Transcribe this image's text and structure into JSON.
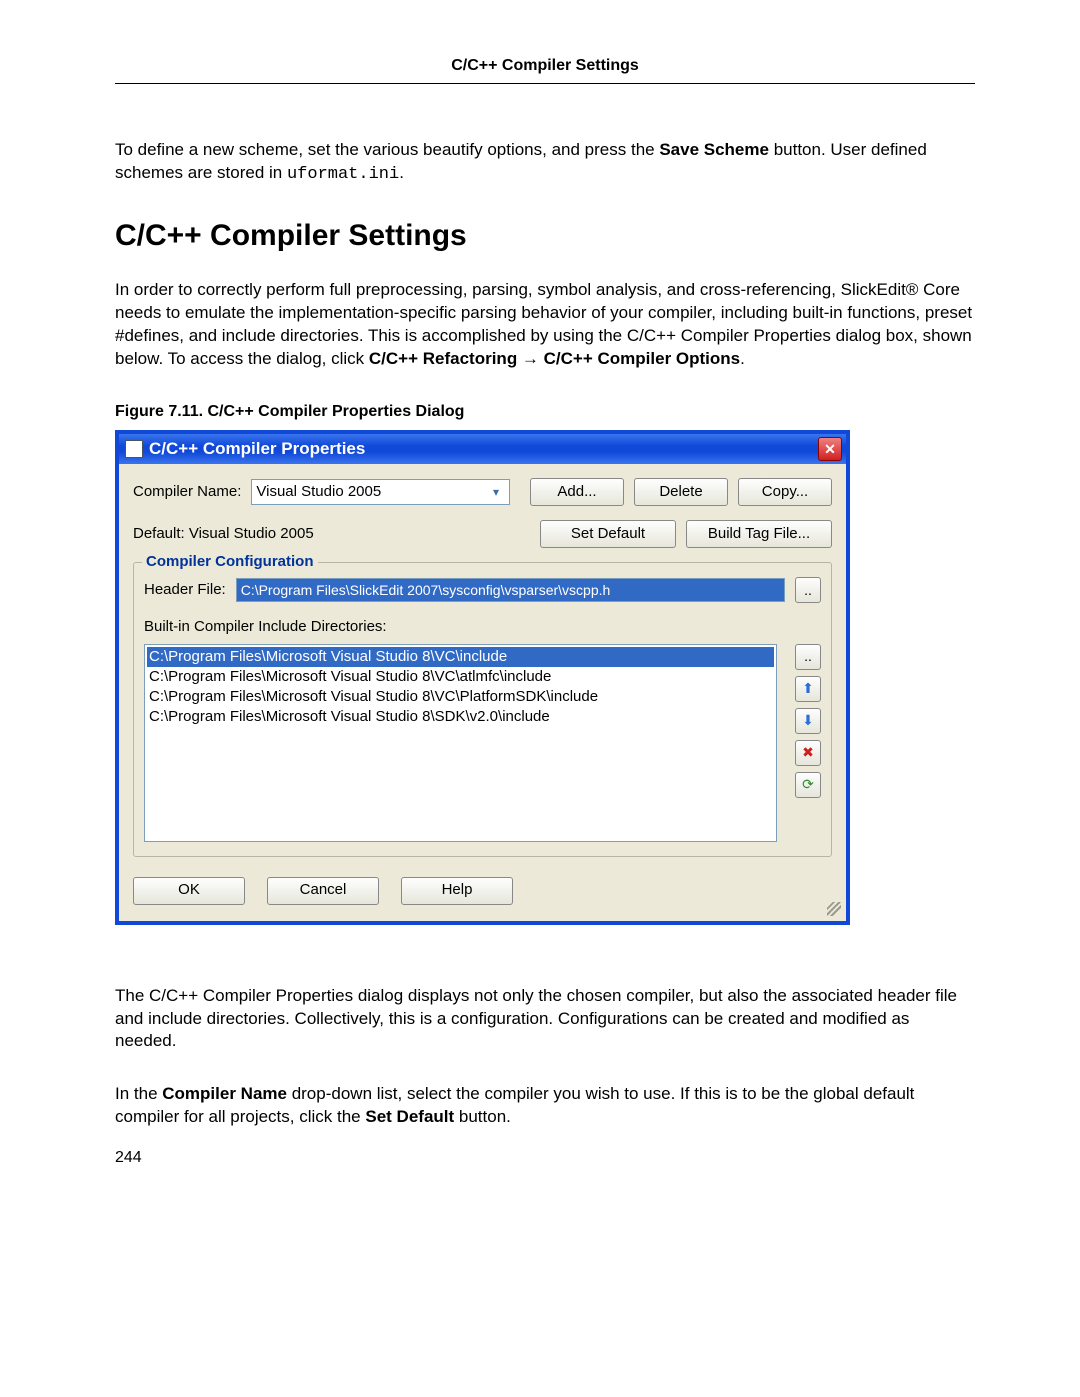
{
  "header": {
    "title": "C/C++ Compiler Settings"
  },
  "intro": {
    "para1_a": "To define a new scheme, set the various beautify options, and press the ",
    "para1_bold": "Save Scheme",
    "para1_b": " button. User defined schemes are stored in ",
    "para1_code": "uformat.ini",
    "para1_c": "."
  },
  "section": {
    "heading": "C/C++ Compiler Settings"
  },
  "para2": {
    "a": "In order to correctly perform full preprocessing, parsing, symbol analysis, and cross-referencing, SlickEdit",
    "reg": "®",
    "b": " Core needs to emulate the implementation-specific parsing behavior of your compiler, including built-in functions, preset #defines, and include directories. This is accomplished by using the C/C++ Compiler Properties dialog box, shown below. To access the dialog, click ",
    "bold1": "C/C++ Refactoring",
    "arrow": " → ",
    "bold2": "C/C++ Compiler Options",
    "c": "."
  },
  "figure": {
    "caption": "Figure 7.11.  C/C++ Compiler Properties Dialog"
  },
  "dialog": {
    "title": "C/C++ Compiler Properties",
    "compiler_name_label": "Compiler Name:",
    "compiler_name_value": "Visual Studio 2005",
    "btn_add": "Add...",
    "btn_delete": "Delete",
    "btn_copy": "Copy...",
    "default_label": "Default: Visual Studio 2005",
    "btn_set_default": "Set Default",
    "btn_build_tag": "Build Tag File...",
    "group_title": "Compiler Configuration",
    "header_file_label": "Header File:",
    "header_file_value": "C:\\Program Files\\SlickEdit 2007\\sysconfig\\vsparser\\vscpp.h",
    "include_label": "Built-in Compiler Include Directories:",
    "includes": [
      "C:\\Program Files\\Microsoft Visual Studio 8\\VC\\include",
      "C:\\Program Files\\Microsoft Visual Studio 8\\VC\\atlmfc\\include",
      "C:\\Program Files\\Microsoft Visual Studio 8\\VC\\PlatformSDK\\include",
      "C:\\Program Files\\Microsoft Visual Studio 8\\SDK\\v2.0\\include"
    ],
    "btn_ok": "OK",
    "btn_cancel": "Cancel",
    "btn_help": "Help"
  },
  "after": {
    "p1": "The C/C++ Compiler Properties dialog displays not only the chosen compiler, but also the associated header file and include directories. Collectively, this is a configuration. Configurations can be created and modified as needed.",
    "p2a": "In the ",
    "p2bold1": "Compiler Name",
    "p2b": " drop-down list, select the compiler you wish to use. If this is to be the global default compiler for all projects, click the ",
    "p2bold2": "Set Default",
    "p2c": " button."
  },
  "page_number": "244"
}
